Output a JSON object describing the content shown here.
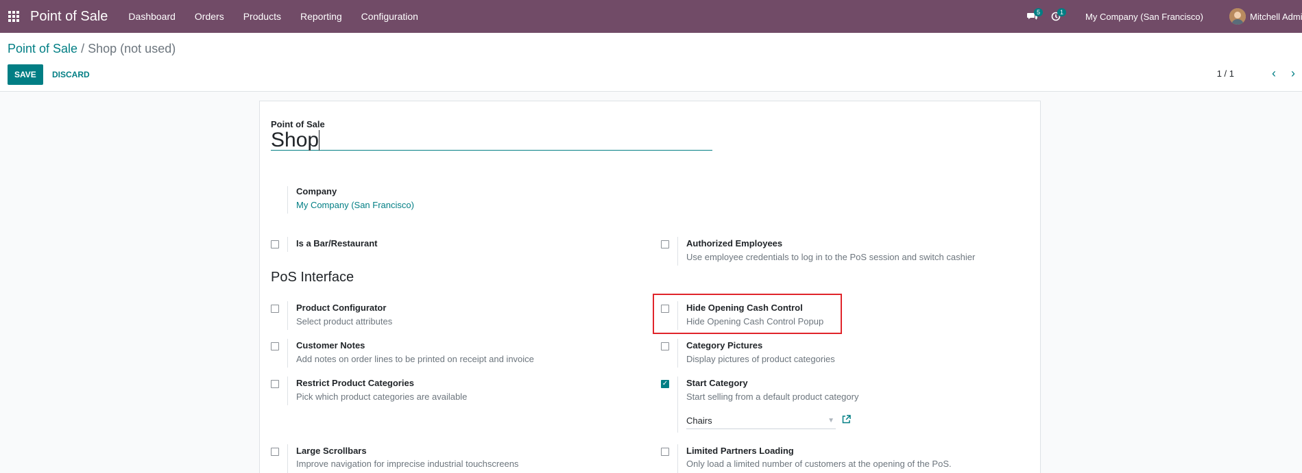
{
  "nav": {
    "brand": "Point of Sale",
    "menu": [
      "Dashboard",
      "Orders",
      "Products",
      "Reporting",
      "Configuration"
    ],
    "messages_badge": "5",
    "activities_badge": "1",
    "company": "My Company (San Francisco)",
    "user": "Mitchell Admin"
  },
  "breadcrumb": {
    "parent": "Point of Sale",
    "separator": "/",
    "current": "Shop (not used)"
  },
  "buttons": {
    "save": "SAVE",
    "discard": "DISCARD"
  },
  "pager": {
    "value": "1 / 1"
  },
  "form": {
    "name_label": "Point of Sale",
    "name_value": "Shop",
    "company_label": "Company",
    "company_value": "My Company (San Francisco)",
    "section_title": "PoS Interface",
    "settings": {
      "bar_restaurant": {
        "title": "Is a Bar/Restaurant",
        "checked": false
      },
      "authorized_employees": {
        "title": "Authorized Employees",
        "desc": "Use employee credentials to log in to the PoS session and switch cashier",
        "checked": false
      },
      "product_configurator": {
        "title": "Product Configurator",
        "desc": "Select product attributes",
        "checked": false
      },
      "hide_cash_control": {
        "title": "Hide Opening Cash Control",
        "desc": "Hide Opening Cash Control Popup",
        "checked": false
      },
      "customer_notes": {
        "title": "Customer Notes",
        "desc": "Add notes on order lines to be printed on receipt and invoice",
        "checked": false
      },
      "category_pictures": {
        "title": "Category Pictures",
        "desc": "Display pictures of product categories",
        "checked": false
      },
      "restrict_categories": {
        "title": "Restrict Product Categories",
        "desc": "Pick which product categories are available",
        "checked": false
      },
      "start_category": {
        "title": "Start Category",
        "desc": "Start selling from a default product category",
        "checked": true,
        "value": "Chairs"
      },
      "large_scrollbars": {
        "title": "Large Scrollbars",
        "desc": "Improve navigation for imprecise industrial touchscreens",
        "checked": false
      },
      "limited_partners": {
        "title": "Limited Partners Loading",
        "desc": "Only load a limited number of customers at the opening of the PoS.",
        "checked": false
      }
    }
  },
  "colors": {
    "navbar": "#714b67",
    "accent": "#017e84",
    "highlight": "#e0242a"
  }
}
